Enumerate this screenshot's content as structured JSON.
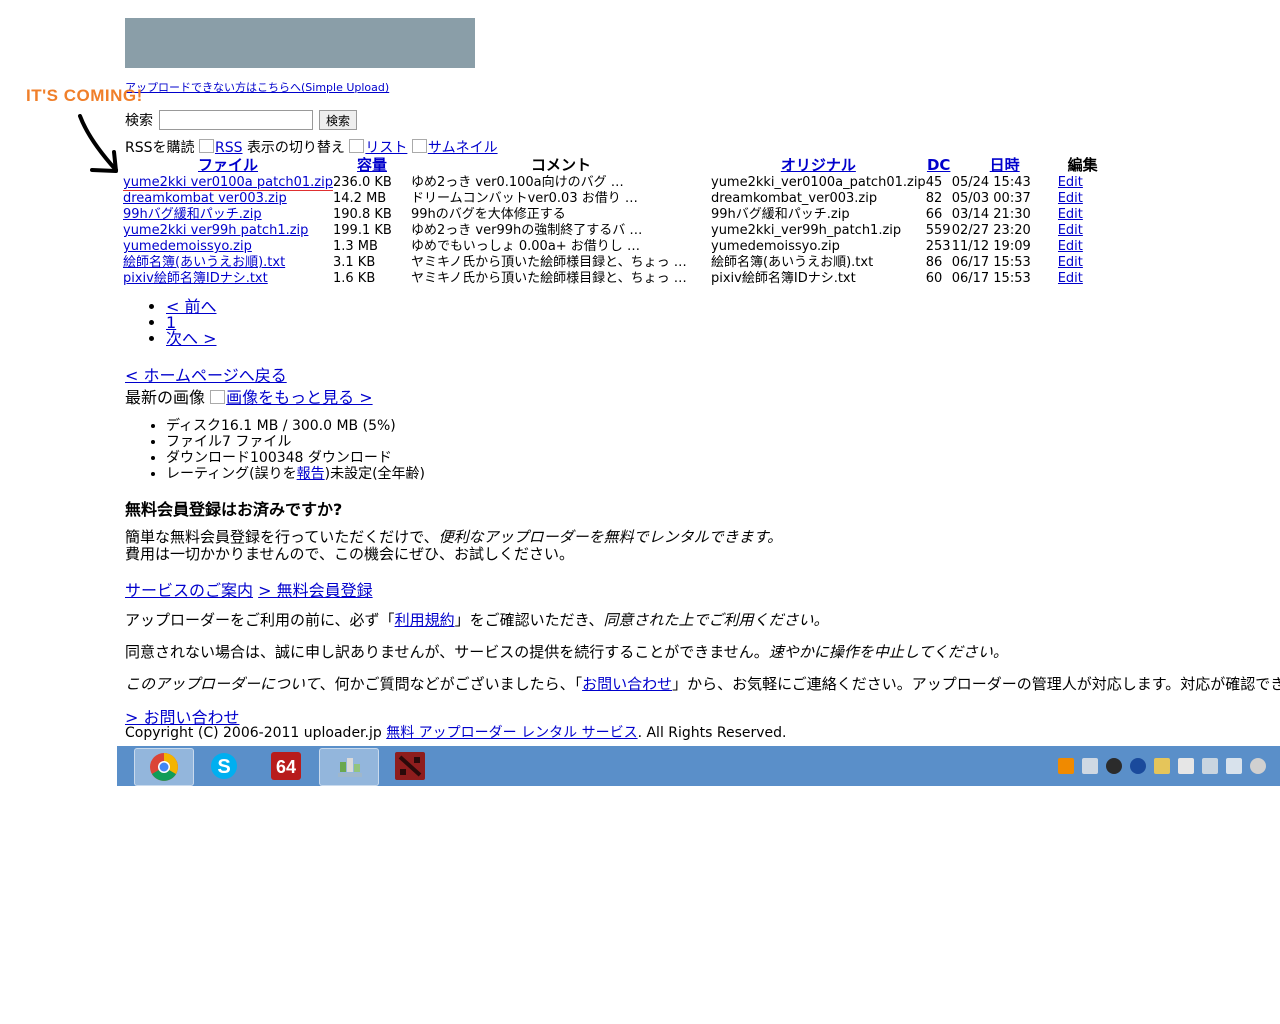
{
  "header": {
    "simple_upload_link": "アップロードできない方はこちらへ(Simple Upload)"
  },
  "annotation": {
    "text": "IT'S COMING!"
  },
  "search": {
    "label": "検索",
    "value": "",
    "button": "検索"
  },
  "view": {
    "rss_subscribe": "RSSを購読",
    "rss_link": "RSS",
    "switch_label": "表示の切り替え",
    "list_link": "リスト",
    "thumb_link": "サムネイル"
  },
  "table": {
    "headers": [
      "ファイル",
      "容量",
      "コメント",
      "オリジナル",
      "DC",
      "日時",
      "編集"
    ],
    "rows": [
      {
        "name": "yume2kki ver0100a patch01.zip",
        "size": "236.0 KB",
        "comment": "ゆめ2っき ver0.100a向けのバグ …",
        "original": "yume2kki_ver0100a_patch01.zip",
        "dc": "45",
        "date": "05/24 15:43",
        "edit": "Edit"
      },
      {
        "name": "dreamkombat ver003.zip",
        "size": "14.2 MB",
        "comment": "ドリームコンバットver0.03 お借り …",
        "original": "dreamkombat_ver003.zip",
        "dc": "82",
        "date": "05/03 00:37",
        "edit": "Edit"
      },
      {
        "name": "99hバグ緩和パッチ.zip",
        "size": "190.8 KB",
        "comment": "99hのバグを大体修正する",
        "original": "99hバグ緩和パッチ.zip",
        "dc": "66",
        "date": "03/14 21:30",
        "edit": "Edit"
      },
      {
        "name": "yume2kki ver99h patch1.zip",
        "size": "199.1 KB",
        "comment": "ゆめ2っき ver99hの強制終了するバ …",
        "original": "yume2kki_ver99h_patch1.zip",
        "dc": "559",
        "date": "02/27 23:20",
        "edit": "Edit"
      },
      {
        "name": "yumedemoissyo.zip",
        "size": "1.3 MB",
        "comment": "ゆめでもいっしょ 0.00a+ お借りし …",
        "original": "yumedemoissyo.zip",
        "dc": "253",
        "date": "11/12 19:09",
        "edit": "Edit"
      },
      {
        "name": "絵師名簿(あいうえお順).txt",
        "size": "3.1 KB",
        "comment": "ヤミキノ氏から頂いた絵師様目録と、ちょっ …",
        "original": "絵師名簿(あいうえお順).txt",
        "dc": "86",
        "date": "06/17 15:53",
        "edit": "Edit"
      },
      {
        "name": "pixiv絵師名簿IDナシ.txt",
        "size": "1.6 KB",
        "comment": "ヤミキノ氏から頂いた絵師様目録と、ちょっ …",
        "original": "pixiv絵師名簿IDナシ.txt",
        "dc": "60",
        "date": "06/17 15:53",
        "edit": "Edit"
      }
    ]
  },
  "pager": {
    "prev": "< 前へ",
    "page": "1",
    "next": "次へ >"
  },
  "home_link": "< ホームページへ戻る",
  "latest": {
    "label": "最新の画像",
    "more_link": "画像をもっと見る >"
  },
  "stats": {
    "disk": "ディスク16.1 MB / 300.0 MB (5%)",
    "files": "ファイル7 ファイル",
    "downloads": "ダウンロード100348 ダウンロード",
    "rating_pre": "レーティング(誤りを",
    "rating_link": "報告",
    "rating_post": ")未設定(全年齢)"
  },
  "member": {
    "heading": "無料会員登録はお済みですか?",
    "p1_a": "簡単な無料会員登録を行っていただくだけで、",
    "p1_b": "便利なアップローダーを無料でレンタルできます。",
    "p1_c": "費用は一切かかりませんので、この機会にぜひ、お試しください。",
    "service_link": "サービスのご案内",
    "register_link": "> 無料会員登録"
  },
  "terms": {
    "p2_a": "アップローダーをご利用の前に、必ず「",
    "p2_link": "利用規約",
    "p2_b": "」をご確認いただき、",
    "p2_c": "同意された上でご利用ください。",
    "p3_a": "同意されない場合は、誠に申し訳ありませんが、サービスの提供を続行することができません。",
    "p3_b": "速やかに操作を中止してください。",
    "p4_a": "このアップローダーについて",
    "p4_b": "、何かご質問などがございましたら、「",
    "p4_link": "お問い合わせ",
    "p4_c": "」から、お気軽にご連絡ください。アップローダーの管理人が対応します。対応が確認できない場"
  },
  "footer": {
    "contact_link": "> お問い合わせ",
    "copyright": "Copyright (C) 2006-2011 uploader.jp",
    "rental_link": "無料 アップローダー レンタル サービス",
    "rights": ". All Rights Reserved."
  },
  "taskbar": {
    "apps": [
      "chrome-icon",
      "skype-icon",
      "64-icon",
      "network-app-icon",
      "dota-icon"
    ],
    "app64_label": "64",
    "colors": {
      "bar": "#5a8fc9"
    }
  }
}
